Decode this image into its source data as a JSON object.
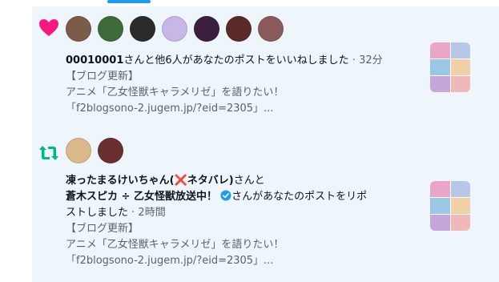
{
  "like_notification": {
    "icon": "heart-icon",
    "avatar_colors": [
      "#7b5b4a",
      "#3e6a3a",
      "#2a2a2a",
      "#c8b6e6",
      "#3b1f3f",
      "#5a2a2a",
      "#8a5a5a"
    ],
    "actor_bold": "00010001",
    "action_text": "さんと他6人があなたのポストをいいねしました",
    "time": "32分",
    "post_line1": "【ブログ更新】",
    "post_line2": "アニメ「乙女怪獣キャラメリゼ」を語りたい！",
    "post_line3": "「f2blogsono-2.jugem.jp/?eid=2305」...",
    "thumb_colors": [
      "#e9a6c9",
      "#b8c7e8",
      "#9ac7e6",
      "#f2d0a6",
      "#c7a6d9",
      "#f0b8b8"
    ]
  },
  "repost_notification": {
    "icon": "repost-icon",
    "avatar_colors": [
      "#d9b88a",
      "#6a3030"
    ],
    "actor1_name": "凍ったまるけいちゃん(",
    "actor1_cross": "❌",
    "actor1_name_end": "ネタバレ)",
    "actor1_suffix": "さんと",
    "actor2_name": "蒼木スピカ ÷ 乙女怪獣放送中！",
    "actor2_suffix": "さんがあなたのポストをリポ",
    "action_line2": "ストしました",
    "time": "2時間",
    "post_line1": "【ブログ更新】",
    "post_line2": "アニメ「乙女怪獣キャラメリゼ」を語りたい！",
    "post_line3": "「f2blogsono-2.jugem.jp/?eid=2305」...",
    "thumb_colors": [
      "#e9a6c9",
      "#b8c7e8",
      "#9ac7e6",
      "#f2d0a6",
      "#c7a6d9",
      "#f0b8b8"
    ]
  },
  "colors": {
    "like": "#f91880",
    "repost": "#00ba7c",
    "accent": "#1d9bf0",
    "background_unread": "#eef6fc"
  }
}
